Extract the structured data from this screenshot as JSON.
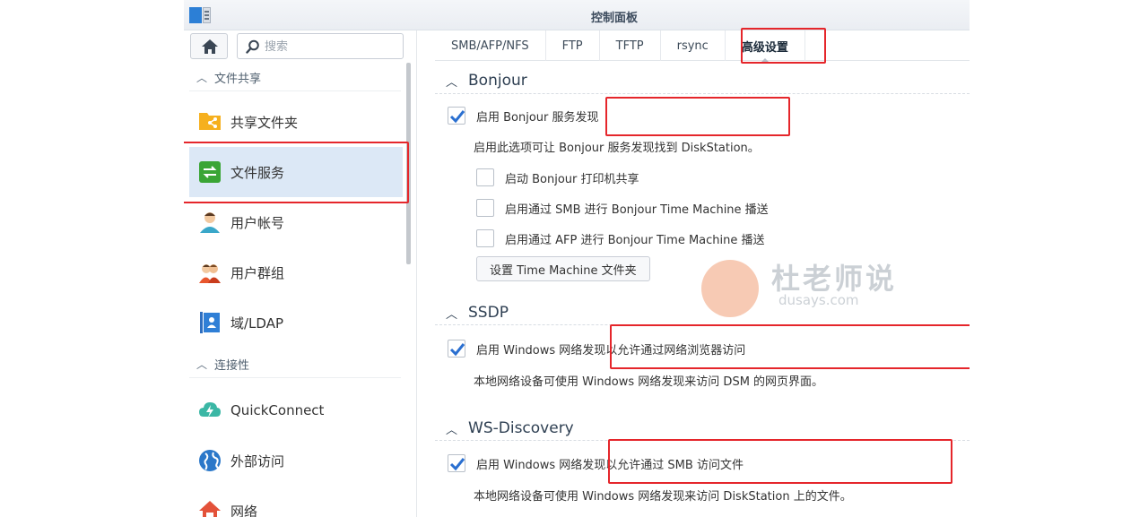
{
  "window": {
    "title": "控制面板"
  },
  "sidebar": {
    "search_placeholder": "搜索",
    "sections": [
      {
        "label": "文件共享"
      },
      {
        "label": "连接性"
      }
    ],
    "items": [
      {
        "label": "共享文件夹"
      },
      {
        "label": "文件服务"
      },
      {
        "label": "用户帐号"
      },
      {
        "label": "用户群组"
      },
      {
        "label": "域/LDAP"
      },
      {
        "label": "QuickConnect"
      },
      {
        "label": "外部访问"
      },
      {
        "label": "网络"
      }
    ]
  },
  "tabs": [
    {
      "label": "SMB/AFP/NFS"
    },
    {
      "label": "FTP"
    },
    {
      "label": "TFTP"
    },
    {
      "label": "rsync"
    },
    {
      "label": "高级设置"
    }
  ],
  "bonjour": {
    "heading": "Bonjour",
    "enable_label": "启用 Bonjour 服务发现",
    "enable_checked": true,
    "description": "启用此选项可让 Bonjour 服务发现找到 DiskStation。",
    "printer_label": "启动 Bonjour 打印机共享",
    "printer_checked": false,
    "smb_tm_label": "启用通过 SMB 进行 Bonjour Time Machine 播送",
    "smb_tm_checked": false,
    "afp_tm_label": "启用通过 AFP 进行 Bonjour Time Machine 播送",
    "afp_tm_checked": false,
    "tm_folder_button": "设置 Time Machine 文件夹"
  },
  "ssdp": {
    "heading": "SSDP",
    "enable_label": "启用 Windows 网络发现以允许通过网络浏览器访问",
    "enable_checked": true,
    "description": "本地网络设备可使用 Windows 网络发现来访问 DSM 的网页界面。"
  },
  "ws_discovery": {
    "heading": "WS-Discovery",
    "enable_label": "启用 Windows 网络发现以允许通过 SMB 访问文件",
    "enable_checked": true,
    "description": "本地网络设备可使用 Windows 网络发现来访问 DiskStation 上的文件。"
  },
  "watermark": {
    "text": "杜老师说",
    "sub": "dusays.com"
  },
  "colors": {
    "highlight_box": "#e5262b",
    "active_item_bg": "#dce8f6",
    "check_blue": "#2a6fd0"
  }
}
